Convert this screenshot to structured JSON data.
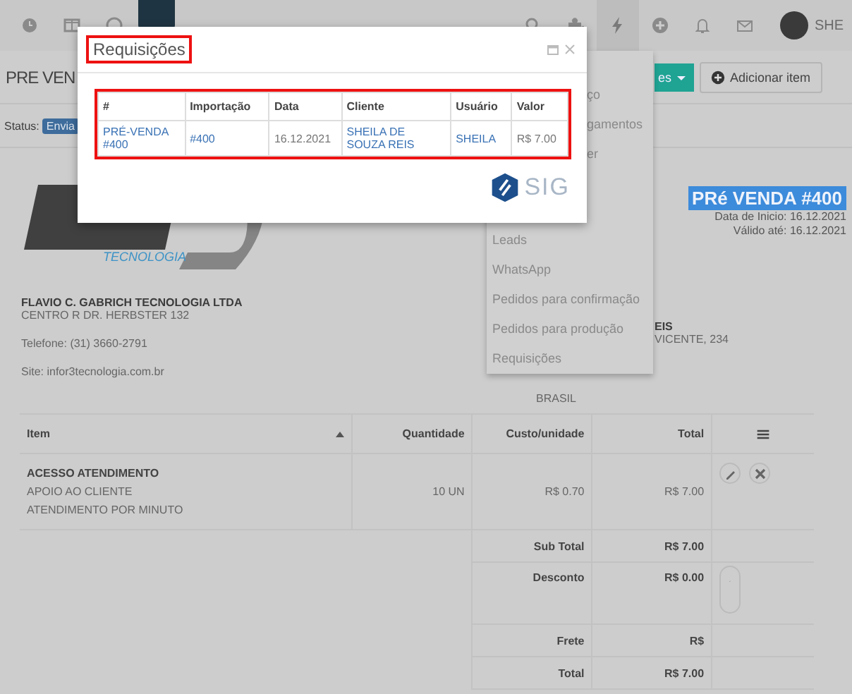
{
  "nav": {
    "user": "SHE"
  },
  "header": {
    "title": "PRE VEN",
    "actions_button": "es",
    "add_button": "Adicionar item"
  },
  "status": {
    "label": "Status:",
    "badge": "Envia"
  },
  "logo": {
    "tagline": "TECNOLOGIA"
  },
  "company": {
    "name": "FLAVIO C. GABRICH TECNOLOGIA LTDA",
    "address": "CENTRO R DR. HERBSTER 132",
    "phone": "Telefone: (31) 3660-2791",
    "site": "Site: infor3tecnologia.com.br"
  },
  "document": {
    "title": "PRé VENDA #400",
    "start": "Data de Inicio: 16.12.2021",
    "valid": "Válido até: 16.12.2021"
  },
  "client": {
    "name": "EIS",
    "address": "VICENTE, 234",
    "country": "BRASIL"
  },
  "items_table": {
    "columns": [
      "Item",
      "Quantidade",
      "Custo/unidade",
      "Total"
    ],
    "rows": [
      {
        "title": "ACESSO ATENDIMENTO",
        "lines": [
          "APOIO AO CLIENTE",
          "ATENDIMENTO POR MINUTO"
        ],
        "quantity": "10 UN",
        "unit_cost": "R$ 0.70",
        "total": "R$ 7.00"
      }
    ],
    "summary": [
      {
        "label": "Sub Total",
        "value": "R$ 7.00",
        "editable": false
      },
      {
        "label": "Desconto",
        "value": "R$ 0.00",
        "editable": true
      },
      {
        "label": "Frete",
        "value": "R$",
        "editable": false
      },
      {
        "label": "Total",
        "value": "R$ 7.00",
        "editable": false
      }
    ]
  },
  "menu": {
    "items": [
      {
        "label": "ço",
        "kind": "clipped"
      },
      {
        "label": "gamentos",
        "kind": "clipped"
      },
      {
        "label": "er",
        "kind": "clipped"
      },
      {
        "label": "Leads",
        "kind": "full"
      },
      {
        "label": "WhatsApp",
        "kind": "full"
      },
      {
        "label": "Pedidos para confirmação",
        "kind": "full"
      },
      {
        "label": "Pedidos para produção",
        "kind": "full"
      },
      {
        "label": "Requisições",
        "kind": "full"
      }
    ]
  },
  "modal": {
    "title": "Requisições",
    "columns": [
      "#",
      "Importação",
      "Data",
      "Cliente",
      "Usuário",
      "Valor"
    ],
    "rows": [
      {
        "cells": [
          {
            "text": "PRÉ-VENDA #400",
            "kind": "link"
          },
          {
            "text": "#400",
            "kind": "link"
          },
          {
            "text": "16.12.2021",
            "kind": "plain"
          },
          {
            "text": "SHEILA DE SOUZA REIS",
            "kind": "link"
          },
          {
            "text": "SHEILA",
            "kind": "link"
          },
          {
            "text": "R$ 7.00",
            "kind": "plain"
          }
        ]
      }
    ],
    "brand": "SIG"
  }
}
